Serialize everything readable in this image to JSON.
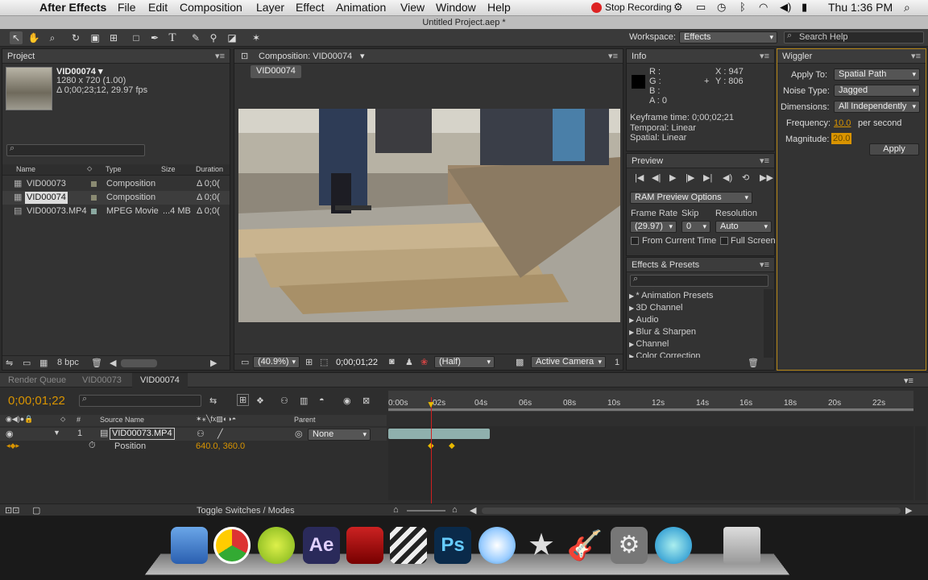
{
  "menubar": {
    "apple": "",
    "app": "After Effects",
    "items": [
      "File",
      "Edit",
      "Composition",
      "Layer",
      "Effect",
      "Animation",
      "View",
      "Window",
      "Help"
    ],
    "stop_recording": "Stop Recording",
    "clock": "Thu 1:36 PM"
  },
  "window_title": "Untitled Project.aep *",
  "workspace": {
    "label": "Workspace:",
    "value": "Effects",
    "search_placeholder": "Search Help"
  },
  "project": {
    "tab": "Project",
    "item_name": "VID00074 ▾",
    "item_res": "1280 x 720 (1.00)",
    "item_dur": "Δ 0;00;23;12, 29.97 fps",
    "columns": [
      "Name",
      "Type",
      "Size",
      "Duration"
    ],
    "rows": [
      {
        "name": "VID00073",
        "type": "Composition",
        "size": "",
        "dur": "Δ 0;0("
      },
      {
        "name": "VID00074",
        "type": "Composition",
        "size": "",
        "dur": "Δ 0;0("
      },
      {
        "name": "VID00073.MP4",
        "type": "MPEG Movie",
        "size": "...4 MB",
        "dur": "Δ 0;0("
      }
    ],
    "bpc": "8 bpc"
  },
  "comp": {
    "tab": "Composition: VID00074",
    "subtab": "VID00074",
    "zoom": "(40.9%)",
    "timecode": "0;00;01;22",
    "resolution": "(Half)",
    "camera": "Active Camera",
    "views": "1"
  },
  "info": {
    "tab": "Info",
    "r": "R :",
    "g": "G :",
    "b": "B :",
    "a": "A : 0",
    "x": "X : 947",
    "y": "Y : 806",
    "keyframe": "Keyframe time: 0;00;02;21",
    "temporal": "Temporal: Linear",
    "spatial": "Spatial: Linear"
  },
  "preview": {
    "tab": "Preview",
    "ram": "RAM Preview Options",
    "frame_rate_label": "Frame Rate",
    "skip_label": "Skip",
    "resolution_label": "Resolution",
    "frame_rate": "(29.97)",
    "skip": "0",
    "resolution": "Auto",
    "from_current": "From Current Time",
    "full_screen": "Full Screen"
  },
  "effects": {
    "tab": "Effects & Presets",
    "items": [
      "* Animation Presets",
      "3D Channel",
      "Audio",
      "Blur & Sharpen",
      "Channel",
      "Color Correction"
    ]
  },
  "wiggler": {
    "tab": "Wiggler",
    "apply_to_label": "Apply To:",
    "apply_to": "Spatial Path",
    "noise_label": "Noise Type:",
    "noise": "Jagged",
    "dim_label": "Dimensions:",
    "dim": "All Independently",
    "freq_label": "Frequency:",
    "freq": "10.0",
    "freq_unit": "per second",
    "mag_label": "Magnitude:",
    "mag": "20.0",
    "apply": "Apply"
  },
  "timeline": {
    "tabs": [
      "Render Queue",
      "VID00073",
      "VID00074"
    ],
    "timecode": "0;00;01;22",
    "ruler": [
      "0:00s",
      "02s",
      "04s",
      "06s",
      "08s",
      "10s",
      "12s",
      "14s",
      "16s",
      "18s",
      "20s",
      "22s"
    ],
    "col_source": "Source Name",
    "col_parent": "Parent",
    "layer_num": "1",
    "layer_name": "VID00073.MP4",
    "parent": "None",
    "prop": "Position",
    "prop_value": "640.0, 360.0",
    "toggle": "Toggle Switches / Modes"
  },
  "colors": {
    "accent": "#f0a000",
    "playhead": "#d02020"
  }
}
